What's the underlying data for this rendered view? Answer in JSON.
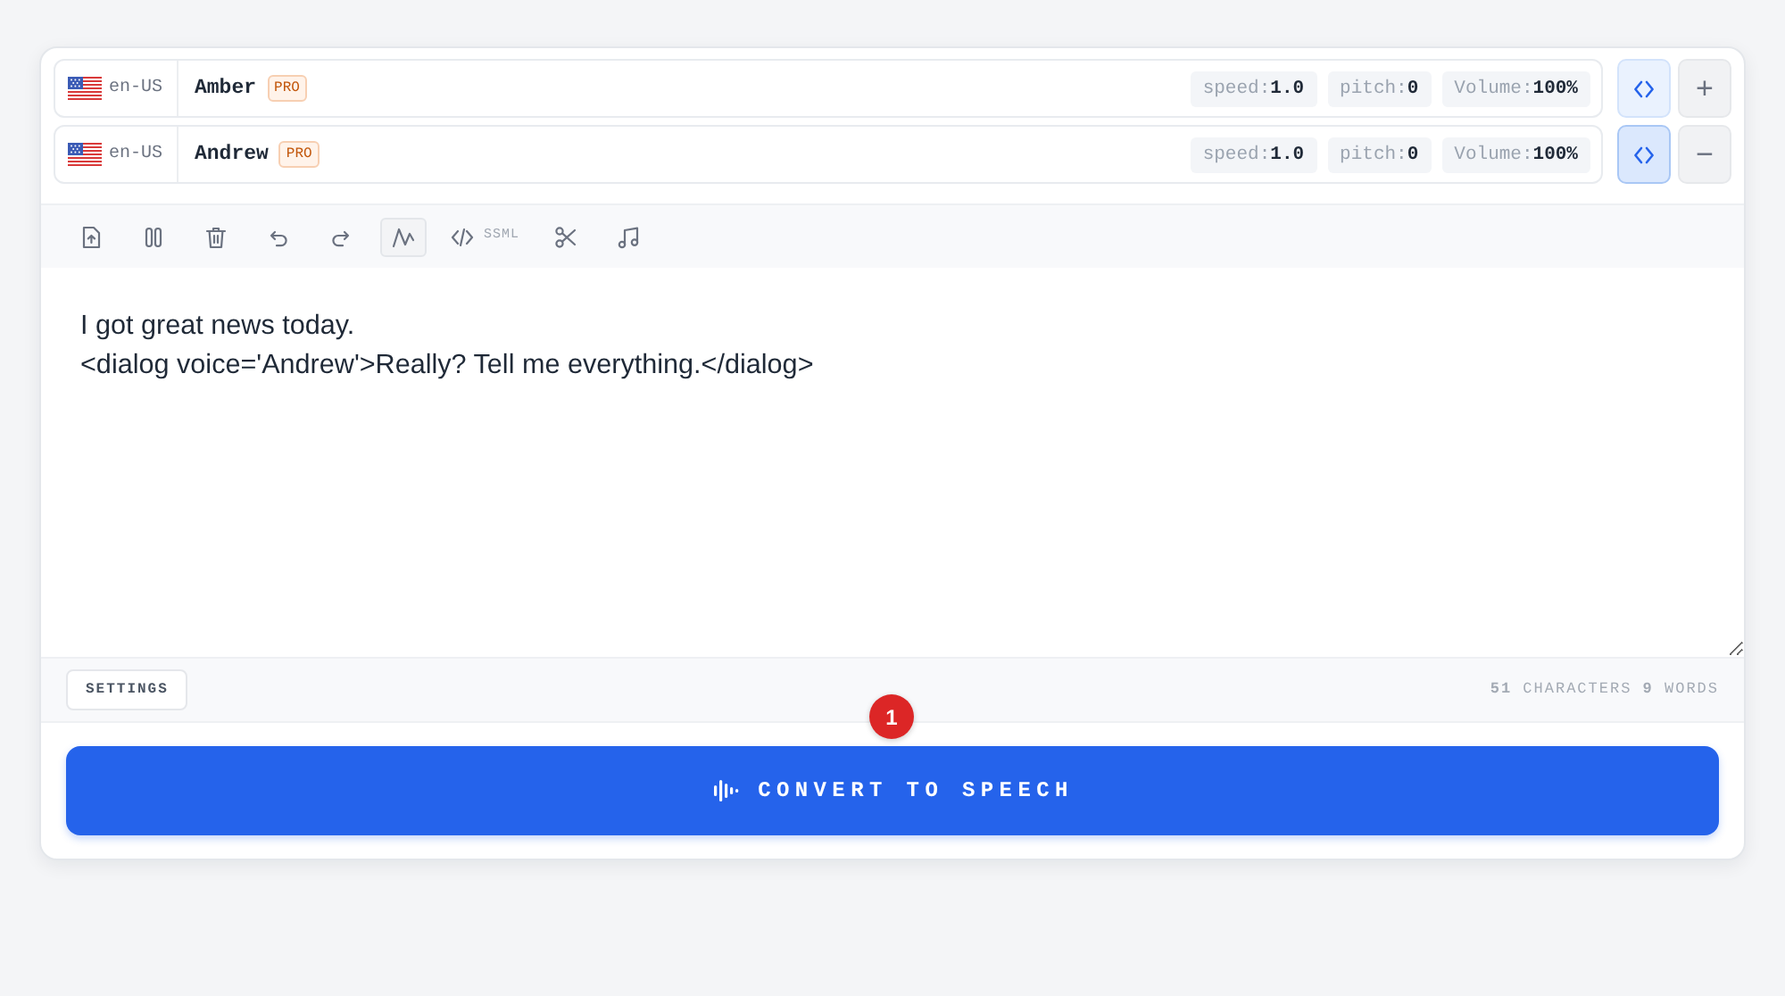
{
  "voices": [
    {
      "locale": "en-US",
      "name": "Amber",
      "tier": "PRO",
      "params": [
        {
          "label": "speed:",
          "value": "1.0"
        },
        {
          "label": "pitch:",
          "value": "0"
        },
        {
          "label": "Volume:",
          "value": "100%"
        }
      ],
      "code_selected": false,
      "action": "+"
    },
    {
      "locale": "en-US",
      "name": "Andrew",
      "tier": "PRO",
      "params": [
        {
          "label": "speed:",
          "value": "1.0"
        },
        {
          "label": "pitch:",
          "value": "0"
        },
        {
          "label": "Volume:",
          "value": "100%"
        }
      ],
      "code_selected": true,
      "action": "−"
    }
  ],
  "toolbar": [
    {
      "kind": "upload",
      "active": false
    },
    {
      "kind": "pause",
      "active": false
    },
    {
      "kind": "delete",
      "active": false
    },
    {
      "kind": "undo",
      "active": false
    },
    {
      "kind": "redo",
      "active": false
    },
    {
      "kind": "waveform",
      "active": true
    },
    {
      "kind": "ssml",
      "label": "SSML",
      "active": false
    },
    {
      "kind": "cut",
      "active": false
    },
    {
      "kind": "music",
      "active": false
    }
  ],
  "editor": {
    "value": "I got great news today.\n<dialog voice='Andrew'>Really? Tell me everything.</dialog>"
  },
  "footer": {
    "settings_button": "SETTINGS",
    "counter": "**51** CHARACTERS **9** WORDS"
  },
  "convert": {
    "label": "CONVERT TO SPEECH",
    "badge": "1"
  }
}
